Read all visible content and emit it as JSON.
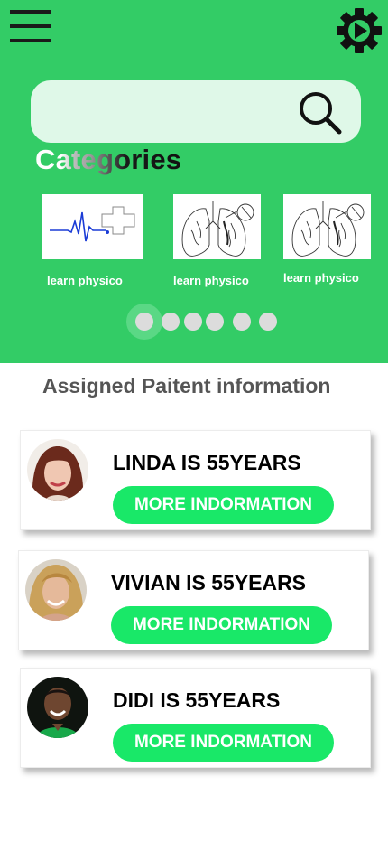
{
  "header": {
    "menu_icon": "hamburger-menu-icon",
    "settings_icon": "gear-icon"
  },
  "search": {
    "value": "",
    "placeholder": "",
    "icon": "search-icon"
  },
  "categories": {
    "title": "Categories",
    "items": [
      {
        "label": "learn physico",
        "icon": "heartbeat-medical-cross-icon"
      },
      {
        "label": "learn physico",
        "icon": "lungs-illustration-icon"
      },
      {
        "label": "learn physico",
        "icon": "lungs-illustration-icon"
      }
    ],
    "pagination": {
      "count": 6,
      "active": 1
    }
  },
  "patients": {
    "title": "Assigned Paitent information",
    "items": [
      {
        "name": "LINDA IS 55YEARS",
        "button": "MORE INDORMATION"
      },
      {
        "name": "VIVIAN IS 55YEARS",
        "button": "MORE INDORMATION"
      },
      {
        "name": "DIDI IS 55YEARS",
        "button": "MORE INDORMATION"
      }
    ]
  },
  "colors": {
    "hero_green": "#33cc66",
    "search_bg": "#dff8e8",
    "button_green": "#19e868",
    "section_title": "#555555"
  }
}
